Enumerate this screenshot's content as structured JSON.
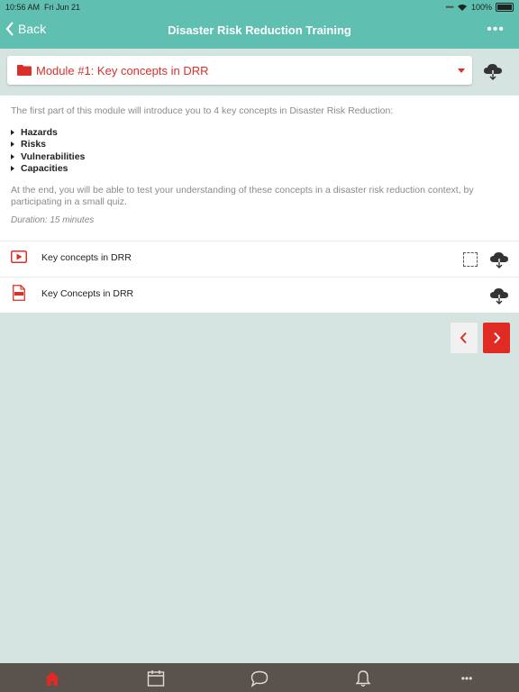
{
  "status_bar": {
    "time": "10:56 AM",
    "date": "Fri Jun 21",
    "battery": "100%"
  },
  "nav": {
    "back_label": "Back",
    "title": "Disaster Risk Reduction Training",
    "more_label": "•••"
  },
  "module_select": {
    "label": "Module #1: Key concepts in DRR",
    "accent_color": "#d9302a"
  },
  "content": {
    "intro": "The first part of this module will introduce you to 4 key concepts in Disaster Risk Reduction:",
    "bullets": [
      "Hazards",
      "Risks",
      "Vulnerabilities",
      "Capacities"
    ],
    "outro": "At the end, you will be able to test your understanding of these concepts in a disaster risk reduction context, by participating in a small quiz.",
    "duration": "Duration: 15 minutes"
  },
  "items": [
    {
      "label": "Key concepts in DRR",
      "icon": "play-video-icon"
    },
    {
      "label": "Key Concepts in DRR",
      "icon": "pdf-icon"
    }
  ],
  "pager": {
    "prev_icon": "chevron-left-icon",
    "next_icon": "chevron-right-icon"
  },
  "tabbar": {
    "tabs": [
      "home-icon",
      "calendar-icon",
      "chat-icon",
      "bell-icon",
      "more-icon"
    ],
    "more_label": "•••"
  },
  "colors": {
    "header": "#5fbfb0",
    "background": "#d5e4e1",
    "accent": "#e02b24",
    "tabbar": "#5a524c"
  }
}
